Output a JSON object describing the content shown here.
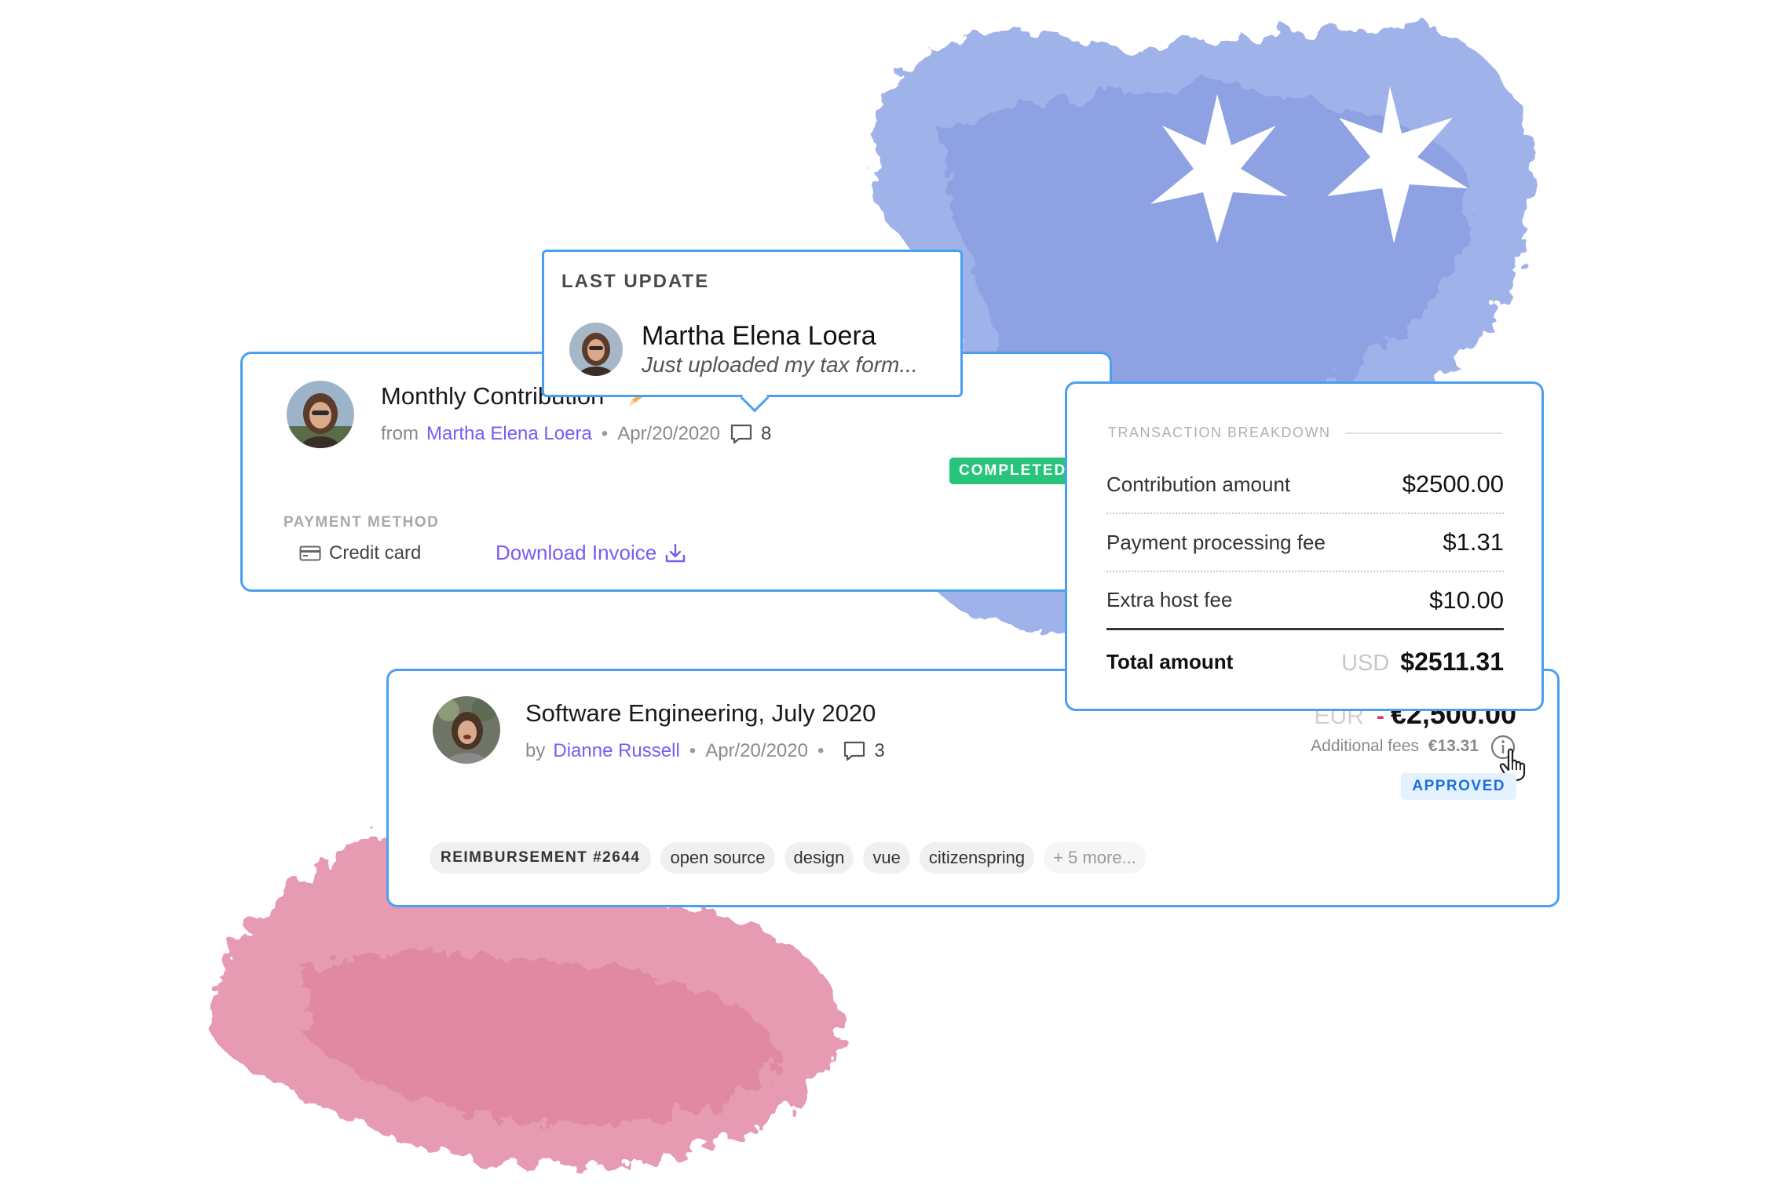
{
  "colors": {
    "card_border": "#4b9ff0",
    "link": "#7a5af5",
    "completed_badge": "#29c47c",
    "approved_badge_text": "#1f6fe0",
    "negative_sign": "#e0365f",
    "blue_watercolor": "#93a7e8",
    "pink_watercolor": "#e48aa6"
  },
  "contribution_card": {
    "title": "Monthly Contribution",
    "title_emoji": "pencil-emoji",
    "from_prefix": "from",
    "contributor": "Martha Elena Loera",
    "date": "Apr/20/2020",
    "comment_count": "8",
    "status": "COMPLETED",
    "payment_method_label": "PAYMENT METHOD",
    "payment_method": "Credit card",
    "payment_icon": "credit-card-icon",
    "download_label": "Download Invoice",
    "download_icon": "download-icon"
  },
  "popover": {
    "label": "LAST UPDATE",
    "name": "Martha Elena Loera",
    "message": "Just uploaded my tax form..."
  },
  "breakdown": {
    "title": "TRANSACTION BREAKDOWN",
    "rows": [
      {
        "label": "Contribution amount",
        "value": "$2500.00"
      },
      {
        "label": "Payment processing fee",
        "value": "$1.31"
      },
      {
        "label": "Extra host fee",
        "value": "$10.00"
      }
    ],
    "total": {
      "label": "Total amount",
      "currency": "USD",
      "value": "$2511.31"
    }
  },
  "expense_card": {
    "title": "Software Engineering, July 2020",
    "by_prefix": "by",
    "submitter": "Dianne Russell",
    "date": "Apr/20/2020",
    "comment_count": "3",
    "currency": "EUR",
    "sign": "-",
    "amount": "€2,500.00",
    "fees_label": "Additional fees",
    "fees_value": "€13.31",
    "status": "APPROVED",
    "tags": [
      {
        "label": "REIMBURSEMENT #2644",
        "kind": "type"
      },
      {
        "label": "open source",
        "kind": "tag"
      },
      {
        "label": "design",
        "kind": "tag"
      },
      {
        "label": "vue",
        "kind": "tag"
      },
      {
        "label": "citizenspring",
        "kind": "tag"
      },
      {
        "label": "+ 5 more...",
        "kind": "more"
      }
    ]
  }
}
